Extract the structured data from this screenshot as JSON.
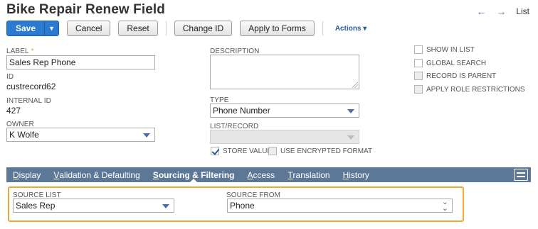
{
  "page": {
    "title": "Bike Repair Renew Field"
  },
  "nav": {
    "back_icon": "arrow-left-icon",
    "forward_icon": "arrow-right-icon",
    "list_label": "List"
  },
  "toolbar": {
    "save_label": "Save",
    "cancel_label": "Cancel",
    "reset_label": "Reset",
    "change_id_label": "Change ID",
    "apply_to_forms_label": "Apply to Forms",
    "actions_label": "Actions"
  },
  "form": {
    "label": {
      "caption": "LABEL",
      "required_mark": "*",
      "value": "Sales Rep Phone"
    },
    "id": {
      "caption": "ID",
      "value": "custrecord62"
    },
    "internal_id": {
      "caption": "INTERNAL ID",
      "value": "427"
    },
    "owner": {
      "caption": "OWNER",
      "value": "K Wolfe"
    },
    "description": {
      "caption": "DESCRIPTION",
      "value": ""
    },
    "type": {
      "caption": "TYPE",
      "value": "Phone Number"
    },
    "list_record": {
      "caption": "LIST/RECORD",
      "value": ""
    },
    "store_value": {
      "label": "STORE VALUE",
      "checked": true
    },
    "use_encrypted_format": {
      "label": "USE ENCRYPTED FORMAT",
      "checked": false,
      "disabled": true
    },
    "options": [
      {
        "label": "SHOW IN LIST",
        "checked": false,
        "disabled": false
      },
      {
        "label": "GLOBAL SEARCH",
        "checked": false,
        "disabled": false
      },
      {
        "label": "RECORD IS PARENT",
        "checked": false,
        "disabled": true
      },
      {
        "label": "APPLY ROLE RESTRICTIONS",
        "checked": false,
        "disabled": true
      }
    ]
  },
  "tabs": [
    {
      "label": "Display",
      "active": false
    },
    {
      "label": "Validation & Defaulting",
      "active": false
    },
    {
      "label": "Sourcing & Filtering",
      "active": true
    },
    {
      "label": "Access",
      "active": false
    },
    {
      "label": "Translation",
      "active": false
    },
    {
      "label": "History",
      "active": false
    }
  ],
  "sourcing": {
    "source_list": {
      "caption": "SOURCE LIST",
      "value": "Sales Rep"
    },
    "source_from": {
      "caption": "SOURCE FROM",
      "value": "Phone"
    }
  },
  "colors": {
    "accent": "#2b7bd2",
    "tabbar": "#5d7896",
    "highlight": "#f0a830",
    "required": "#d4a43a"
  }
}
